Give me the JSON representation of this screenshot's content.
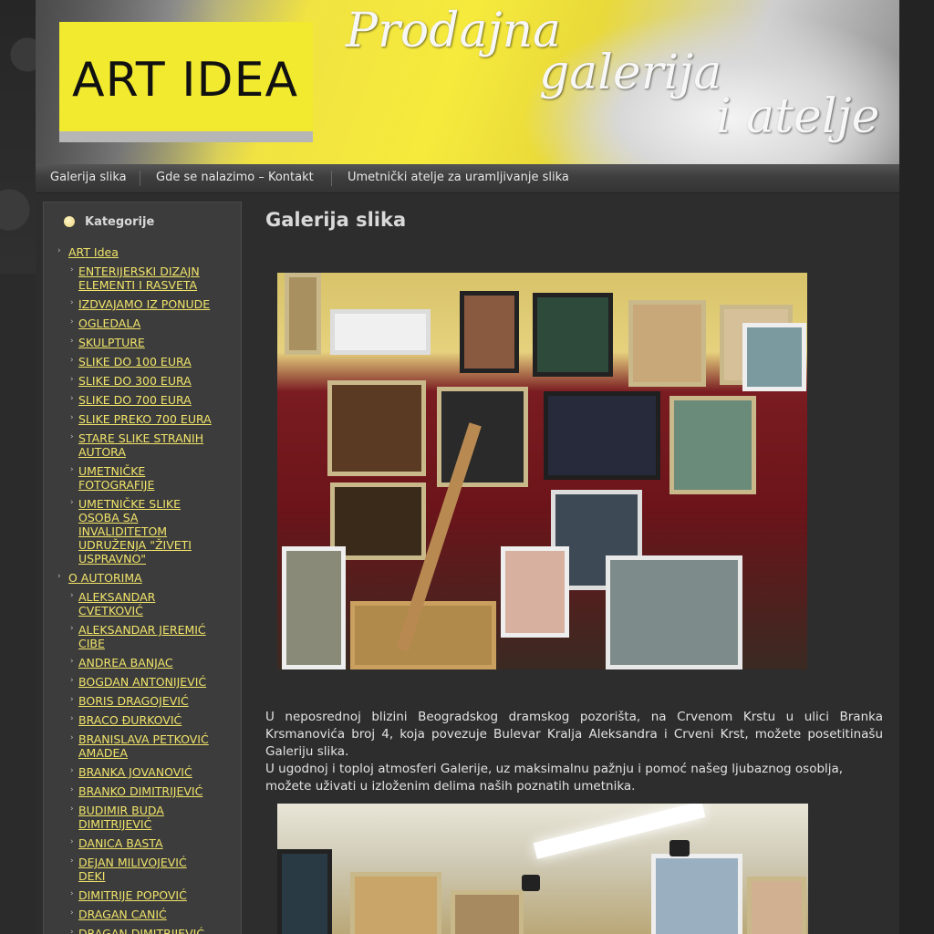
{
  "header": {
    "logo_text": "ART IDEA",
    "tagline_1": "Prodajna",
    "tagline_2": "galerija",
    "tagline_3": "i atelje"
  },
  "nav": {
    "items": [
      "Galerija slika",
      "Gde se nalazimo – Kontakt",
      "Umetnički atelje za uramljivanje slika"
    ]
  },
  "sidebar": {
    "title": "Kategorije",
    "items": [
      {
        "level": 1,
        "label": "ART Idea"
      },
      {
        "level": 2,
        "label": "ENTERIJERSKI DIZAJN ELEMENTI I RASVETA"
      },
      {
        "level": 2,
        "label": "IZDVAJAMO IZ PONUDE"
      },
      {
        "level": 2,
        "label": "OGLEDALA"
      },
      {
        "level": 2,
        "label": "SKULPTURE"
      },
      {
        "level": 2,
        "label": "SLIKE DO 100 EURA"
      },
      {
        "level": 2,
        "label": "SLIKE DO 300 EURA"
      },
      {
        "level": 2,
        "label": "SLIKE DO 700 EURA"
      },
      {
        "level": 2,
        "label": "SLIKE PREKO 700 EURA"
      },
      {
        "level": 2,
        "label": "STARE SLIKE STRANIH AUTORA"
      },
      {
        "level": 2,
        "label": "UMETNIČKE FOTOGRAFIJE"
      },
      {
        "level": 2,
        "label": "UMETNIČKE SLIKE OSOBA SA INVALIDITETOM UDRUŽENJA \"ŽIVETI USPRAVNO\""
      },
      {
        "level": 1,
        "label": "O AUTORIMA"
      },
      {
        "level": 2,
        "label": "ALEKSANDAR CVETKOVIĆ"
      },
      {
        "level": 2,
        "label": "ALEKSANDAR JEREMIĆ CIBE"
      },
      {
        "level": 2,
        "label": "ANDREA BANJAC"
      },
      {
        "level": 2,
        "label": "BOGDAN ANTONIJEVIĆ"
      },
      {
        "level": 2,
        "label": "BORIS DRAGOJEVIĆ"
      },
      {
        "level": 2,
        "label": "BRACO ĐURKOVIĆ"
      },
      {
        "level": 2,
        "label": "BRANISLAVA PETKOVIĆ AMADEA"
      },
      {
        "level": 2,
        "label": "BRANKA JOVANOVIĆ"
      },
      {
        "level": 2,
        "label": "BRANKO DIMITRIJEVIĆ"
      },
      {
        "level": 2,
        "label": "BUDIMIR BUDA DIMITRIJEVIĆ"
      },
      {
        "level": 2,
        "label": "DANICA BASTA"
      },
      {
        "level": 2,
        "label": "DEJAN MILIVOJEVIĆ DEKI"
      },
      {
        "level": 2,
        "label": "DIMITRIJE POPOVIĆ"
      },
      {
        "level": 2,
        "label": "DRAGAN CANIĆ"
      },
      {
        "level": 2,
        "label": "DRAGAN DIMITRIJEVIĆ"
      }
    ]
  },
  "main": {
    "title": "Galerija slika",
    "paragraph_1": "U neposrednoj blizini Beogradskog dramskog pozorišta, na Crvenom Krstu u ulici Branka Krsmanovića broj 4, koja povezuje Bulevar Kralja Aleksandra i Crveni Krst, možete posetitinašu Galeriju slika.",
    "paragraph_2": "U ugodnoj i toploj atmosferi Galerije, uz maksimalnu pažnju i pomoć našeg ljubaznog osoblja, možete uživati u izloženim delima naših poznatih umetnika."
  },
  "colors": {
    "link": "#f1e46a",
    "logo_yellow": "#f2ea2f",
    "background": "#2b2b2b"
  }
}
